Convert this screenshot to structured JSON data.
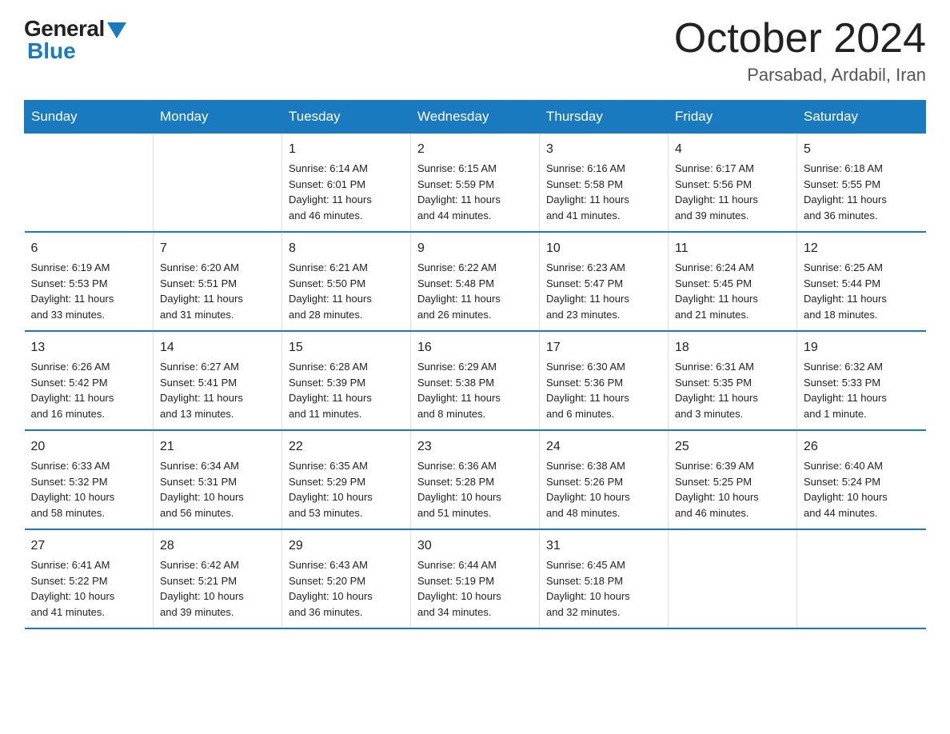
{
  "header": {
    "logo_general": "General",
    "logo_blue": "Blue",
    "month_title": "October 2024",
    "subtitle": "Parsabad, Ardabil, Iran"
  },
  "weekdays": [
    "Sunday",
    "Monday",
    "Tuesday",
    "Wednesday",
    "Thursday",
    "Friday",
    "Saturday"
  ],
  "weeks": [
    [
      {
        "day": "",
        "info": ""
      },
      {
        "day": "",
        "info": ""
      },
      {
        "day": "1",
        "info": "Sunrise: 6:14 AM\nSunset: 6:01 PM\nDaylight: 11 hours\nand 46 minutes."
      },
      {
        "day": "2",
        "info": "Sunrise: 6:15 AM\nSunset: 5:59 PM\nDaylight: 11 hours\nand 44 minutes."
      },
      {
        "day": "3",
        "info": "Sunrise: 6:16 AM\nSunset: 5:58 PM\nDaylight: 11 hours\nand 41 minutes."
      },
      {
        "day": "4",
        "info": "Sunrise: 6:17 AM\nSunset: 5:56 PM\nDaylight: 11 hours\nand 39 minutes."
      },
      {
        "day": "5",
        "info": "Sunrise: 6:18 AM\nSunset: 5:55 PM\nDaylight: 11 hours\nand 36 minutes."
      }
    ],
    [
      {
        "day": "6",
        "info": "Sunrise: 6:19 AM\nSunset: 5:53 PM\nDaylight: 11 hours\nand 33 minutes."
      },
      {
        "day": "7",
        "info": "Sunrise: 6:20 AM\nSunset: 5:51 PM\nDaylight: 11 hours\nand 31 minutes."
      },
      {
        "day": "8",
        "info": "Sunrise: 6:21 AM\nSunset: 5:50 PM\nDaylight: 11 hours\nand 28 minutes."
      },
      {
        "day": "9",
        "info": "Sunrise: 6:22 AM\nSunset: 5:48 PM\nDaylight: 11 hours\nand 26 minutes."
      },
      {
        "day": "10",
        "info": "Sunrise: 6:23 AM\nSunset: 5:47 PM\nDaylight: 11 hours\nand 23 minutes."
      },
      {
        "day": "11",
        "info": "Sunrise: 6:24 AM\nSunset: 5:45 PM\nDaylight: 11 hours\nand 21 minutes."
      },
      {
        "day": "12",
        "info": "Sunrise: 6:25 AM\nSunset: 5:44 PM\nDaylight: 11 hours\nand 18 minutes."
      }
    ],
    [
      {
        "day": "13",
        "info": "Sunrise: 6:26 AM\nSunset: 5:42 PM\nDaylight: 11 hours\nand 16 minutes."
      },
      {
        "day": "14",
        "info": "Sunrise: 6:27 AM\nSunset: 5:41 PM\nDaylight: 11 hours\nand 13 minutes."
      },
      {
        "day": "15",
        "info": "Sunrise: 6:28 AM\nSunset: 5:39 PM\nDaylight: 11 hours\nand 11 minutes."
      },
      {
        "day": "16",
        "info": "Sunrise: 6:29 AM\nSunset: 5:38 PM\nDaylight: 11 hours\nand 8 minutes."
      },
      {
        "day": "17",
        "info": "Sunrise: 6:30 AM\nSunset: 5:36 PM\nDaylight: 11 hours\nand 6 minutes."
      },
      {
        "day": "18",
        "info": "Sunrise: 6:31 AM\nSunset: 5:35 PM\nDaylight: 11 hours\nand 3 minutes."
      },
      {
        "day": "19",
        "info": "Sunrise: 6:32 AM\nSunset: 5:33 PM\nDaylight: 11 hours\nand 1 minute."
      }
    ],
    [
      {
        "day": "20",
        "info": "Sunrise: 6:33 AM\nSunset: 5:32 PM\nDaylight: 10 hours\nand 58 minutes."
      },
      {
        "day": "21",
        "info": "Sunrise: 6:34 AM\nSunset: 5:31 PM\nDaylight: 10 hours\nand 56 minutes."
      },
      {
        "day": "22",
        "info": "Sunrise: 6:35 AM\nSunset: 5:29 PM\nDaylight: 10 hours\nand 53 minutes."
      },
      {
        "day": "23",
        "info": "Sunrise: 6:36 AM\nSunset: 5:28 PM\nDaylight: 10 hours\nand 51 minutes."
      },
      {
        "day": "24",
        "info": "Sunrise: 6:38 AM\nSunset: 5:26 PM\nDaylight: 10 hours\nand 48 minutes."
      },
      {
        "day": "25",
        "info": "Sunrise: 6:39 AM\nSunset: 5:25 PM\nDaylight: 10 hours\nand 46 minutes."
      },
      {
        "day": "26",
        "info": "Sunrise: 6:40 AM\nSunset: 5:24 PM\nDaylight: 10 hours\nand 44 minutes."
      }
    ],
    [
      {
        "day": "27",
        "info": "Sunrise: 6:41 AM\nSunset: 5:22 PM\nDaylight: 10 hours\nand 41 minutes."
      },
      {
        "day": "28",
        "info": "Sunrise: 6:42 AM\nSunset: 5:21 PM\nDaylight: 10 hours\nand 39 minutes."
      },
      {
        "day": "29",
        "info": "Sunrise: 6:43 AM\nSunset: 5:20 PM\nDaylight: 10 hours\nand 36 minutes."
      },
      {
        "day": "30",
        "info": "Sunrise: 6:44 AM\nSunset: 5:19 PM\nDaylight: 10 hours\nand 34 minutes."
      },
      {
        "day": "31",
        "info": "Sunrise: 6:45 AM\nSunset: 5:18 PM\nDaylight: 10 hours\nand 32 minutes."
      },
      {
        "day": "",
        "info": ""
      },
      {
        "day": "",
        "info": ""
      }
    ]
  ],
  "colors": {
    "header_bg": "#1a7abf",
    "header_text": "#ffffff",
    "border": "#1a7abf",
    "text": "#222222"
  }
}
